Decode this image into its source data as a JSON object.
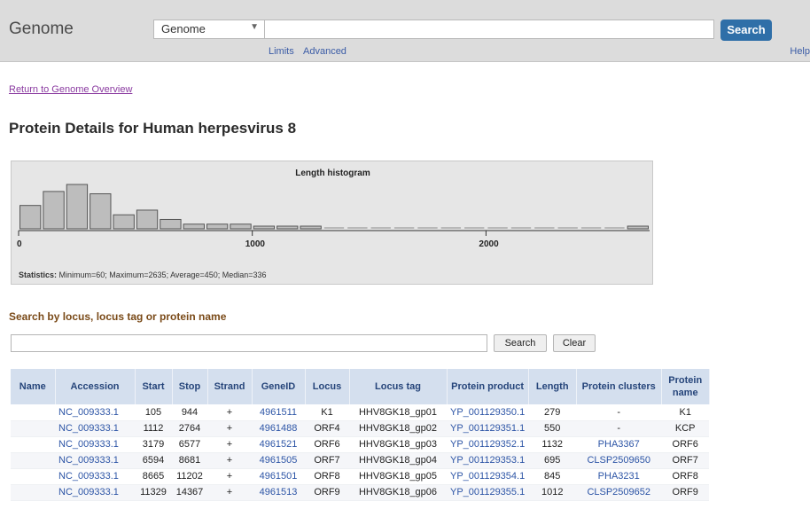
{
  "header": {
    "logo": "Genome",
    "db_select": "Genome",
    "search_value": "",
    "search_button": "Search",
    "links": [
      "Limits",
      "Advanced"
    ],
    "help": "Help"
  },
  "return_link": "Return to Genome Overview",
  "page_title": "Protein Details for Human herpesvirus 8",
  "histogram": {
    "title": "Length histogram",
    "axis_ticks": [
      "0",
      "1000",
      "2000"
    ],
    "stats_label": "Statistics:",
    "stats_text": " Minimum=60; Maximum=2635; Average=450; Median=336",
    "bar_color": "#bdbdbd",
    "bar_stroke": "#555555"
  },
  "chart_data": {
    "type": "bar",
    "title": "Length histogram",
    "bin_width": 100,
    "x_range": [
      0,
      2700
    ],
    "bin_starts": [
      0,
      100,
      200,
      300,
      400,
      500,
      600,
      700,
      800,
      900,
      1000,
      1100,
      1200,
      1300,
      1400,
      1500,
      1600,
      1700,
      1800,
      1900,
      2000,
      2100,
      2200,
      2300,
      2400,
      2500,
      2600
    ],
    "values": [
      10,
      16,
      19,
      15,
      6,
      8,
      4,
      2,
      2,
      2,
      1,
      1,
      1,
      0,
      0,
      0,
      0,
      0,
      0,
      0,
      0,
      0,
      0,
      0,
      0,
      0,
      1
    ],
    "stats": {
      "minimum": 60,
      "maximum": 2635,
      "average": 450,
      "median": 336
    }
  },
  "locus_search": {
    "title": "Search by locus, locus tag or protein name",
    "input_value": "",
    "search_button": "Search",
    "clear_button": "Clear"
  },
  "table": {
    "headers": [
      "Name",
      "Accession",
      "Start",
      "Stop",
      "Strand",
      "GeneID",
      "Locus",
      "Locus tag",
      "Protein product",
      "Length",
      "Protein clusters",
      "Protein name"
    ],
    "rows": [
      [
        "",
        "NC_009333.1",
        "105",
        "944",
        "+",
        "4961511",
        "K1",
        "HHV8GK18_gp01",
        "YP_001129350.1",
        "279",
        "-",
        "K1"
      ],
      [
        "",
        "NC_009333.1",
        "1112",
        "2764",
        "+",
        "4961488",
        "ORF4",
        "HHV8GK18_gp02",
        "YP_001129351.1",
        "550",
        "-",
        "KCP"
      ],
      [
        "",
        "NC_009333.1",
        "3179",
        "6577",
        "+",
        "4961521",
        "ORF6",
        "HHV8GK18_gp03",
        "YP_001129352.1",
        "1132",
        "PHA3367",
        "ORF6"
      ],
      [
        "",
        "NC_009333.1",
        "6594",
        "8681",
        "+",
        "4961505",
        "ORF7",
        "HHV8GK18_gp04",
        "YP_001129353.1",
        "695",
        "CLSP2509650",
        "ORF7"
      ],
      [
        "",
        "NC_009333.1",
        "8665",
        "11202",
        "+",
        "4961501",
        "ORF8",
        "HHV8GK18_gp05",
        "YP_001129354.1",
        "845",
        "PHA3231",
        "ORF8"
      ],
      [
        "",
        "NC_009333.1",
        "11329",
        "14367",
        "+",
        "4961513",
        "ORF9",
        "HHV8GK18_gp06",
        "YP_001129355.1",
        "1012",
        "CLSP2509652",
        "ORF9"
      ]
    ]
  }
}
